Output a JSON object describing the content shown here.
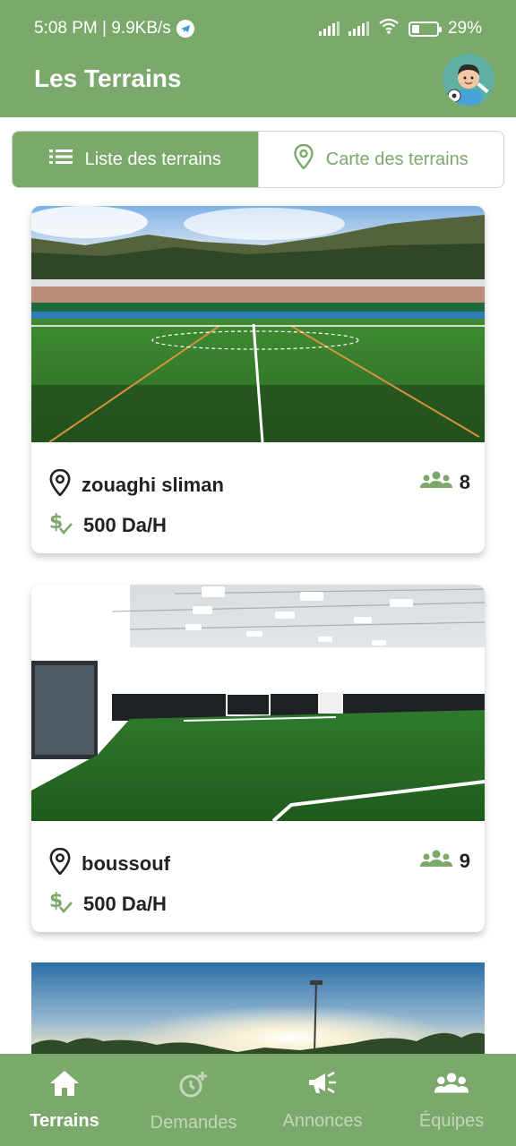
{
  "status_bar": {
    "time_speed": "5:08 PM | 9.9KB/s",
    "battery": "29%",
    "battery_level": 0.29
  },
  "app_bar": {
    "title": "Les Terrains"
  },
  "view_toggle": {
    "list_label": "Liste des terrains",
    "map_label": "Carte des terrains",
    "selected": "list"
  },
  "terrains": [
    {
      "name": "zouaghi sliman",
      "price": "500 Da/H",
      "capacity": "8",
      "image": "outdoor-stadium"
    },
    {
      "name": "boussouf",
      "price": "500 Da/H",
      "capacity": "9",
      "image": "indoor-pitch"
    }
  ],
  "bottom_nav": {
    "items": [
      {
        "label": "Terrains",
        "icon": "home-icon"
      },
      {
        "label": "Demandes",
        "icon": "clock-plus-icon"
      },
      {
        "label": "Annonces",
        "icon": "megaphone-icon"
      },
      {
        "label": "Équipes",
        "icon": "group-icon"
      }
    ],
    "active": "Terrains"
  },
  "colors": {
    "primary": "#7ba86b",
    "inactive_nav": "#c3d8ba",
    "text": "#222222"
  }
}
